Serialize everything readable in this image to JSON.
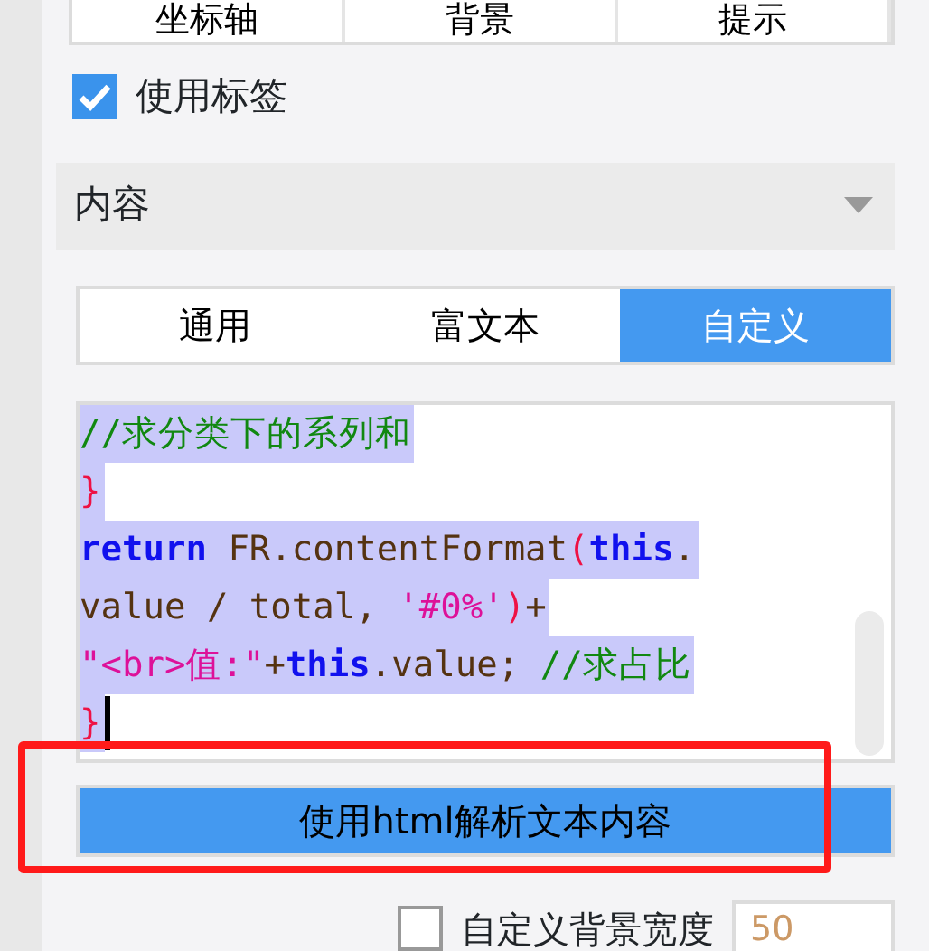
{
  "top_tabs": [
    {
      "label": "坐标轴",
      "selected": false
    },
    {
      "label": "背景",
      "selected": false
    },
    {
      "label": "提示",
      "selected": false
    }
  ],
  "use_label": {
    "label": "使用标签",
    "checked": true
  },
  "content_select": {
    "value": "内容"
  },
  "format_tabs": [
    {
      "label": "通用",
      "selected": false
    },
    {
      "label": "富文本",
      "selected": false
    },
    {
      "label": "自定义",
      "selected": true
    }
  ],
  "code_lines": [
    {
      "selected": true,
      "tokens": [
        {
          "kind": "comment",
          "text": "//求分类下的系列和"
        }
      ]
    },
    {
      "selected": true,
      "tokens": [
        {
          "kind": "brace",
          "text": "}"
        }
      ]
    },
    {
      "selected": true,
      "tokens": [
        {
          "kind": "keyword",
          "text": "return"
        },
        {
          "kind": "plain",
          "text": " FR.contentFormat"
        },
        {
          "kind": "brace",
          "text": "("
        },
        {
          "kind": "keyword",
          "text": "this"
        },
        {
          "kind": "plain",
          "text": "."
        }
      ]
    },
    {
      "selected": true,
      "tokens": [
        {
          "kind": "plain",
          "text": "value / total, "
        },
        {
          "kind": "string",
          "text": "'#0%'"
        },
        {
          "kind": "brace",
          "text": ")"
        },
        {
          "kind": "plain",
          "text": "+"
        }
      ]
    },
    {
      "selected": true,
      "tokens": [
        {
          "kind": "string",
          "text": "\"<br>值:\""
        },
        {
          "kind": "plain",
          "text": "+"
        },
        {
          "kind": "keyword",
          "text": "this"
        },
        {
          "kind": "plain",
          "text": ".value; "
        },
        {
          "kind": "comment",
          "text": "//求占比"
        }
      ]
    },
    {
      "selected": true,
      "tokens": [
        {
          "kind": "brace",
          "text": "}"
        }
      ]
    }
  ],
  "html_button": {
    "label": "使用html解析文本内容",
    "selected": true
  },
  "custom_bg_width": {
    "label": "自定义背景宽度",
    "checked": false,
    "value": "50"
  }
}
